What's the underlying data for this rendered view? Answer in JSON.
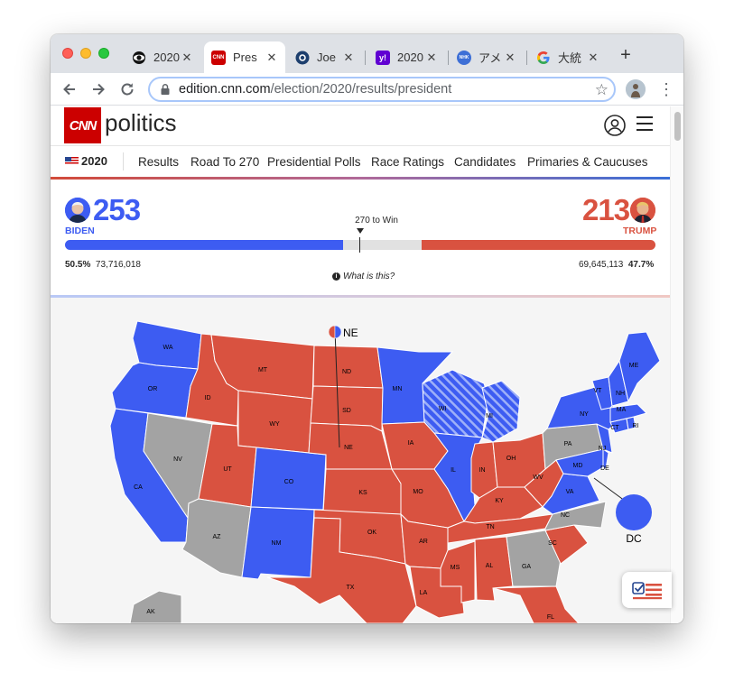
{
  "browser": {
    "tabs": [
      {
        "label": "2020",
        "icon": "cbs-eye-icon"
      },
      {
        "label": "Pres",
        "icon": "cnn-icon",
        "active": true
      },
      {
        "label": "Joe",
        "icon": "globe-icon"
      },
      {
        "label": "2020",
        "icon": "yahoo-icon"
      },
      {
        "label": "アメ",
        "icon": "nhk-icon"
      },
      {
        "label": "大統",
        "icon": "google-icon"
      }
    ],
    "url_host": "edition.cnn.com",
    "url_path": "/election/2020/results/president"
  },
  "cnn": {
    "logo": "CNN",
    "section": "politics",
    "nav": {
      "year": "2020",
      "links": [
        "Results",
        "Road To 270",
        "Presidential Polls",
        "Race Ratings",
        "Candidates",
        "Primaries & Caucuses"
      ]
    }
  },
  "tally": {
    "dem": {
      "name": "BIDEN",
      "electoral": "253",
      "pct": "50.5%",
      "popular": "73,716,018",
      "bar_fraction": 0.4706
    },
    "rep": {
      "name": "TRUMP",
      "electoral": "213",
      "pct": "47.7%",
      "popular": "69,645,113",
      "bar_fraction": 0.3959
    },
    "win_label": "270 to Win",
    "whatis": "What is this?"
  },
  "map": {
    "colors": {
      "dem": "#3d5cf2",
      "rep": "#d95240",
      "undecided": "#a3a3a3"
    },
    "labels": {
      "WA": "WA",
      "OR": "OR",
      "CA": "CA",
      "ID": "ID",
      "NV": "NV",
      "MT": "MT",
      "WY": "WY",
      "UT": "UT",
      "AZ": "AZ",
      "CO": "CO",
      "NM": "NM",
      "ND": "ND",
      "SD": "SD",
      "NE": "NE",
      "KS": "KS",
      "OK": "OK",
      "TX": "TX",
      "MN": "MN",
      "IA": "IA",
      "MO": "MO",
      "AR": "AR",
      "LA": "LA",
      "WI": "WI",
      "IL": "IL",
      "MS": "MS",
      "MI": "MI",
      "IN": "IN",
      "KY": "KY",
      "TN": "TN",
      "AL": "AL",
      "OH": "OH",
      "WV": "WV",
      "GA": "GA",
      "FL": "FL",
      "SC": "SC",
      "NC": "NC",
      "VA": "VA",
      "PA": "PA",
      "MD": "MD",
      "DE": "DE",
      "NJ": "NJ",
      "NY": "NY",
      "CT": "CT",
      "RI": "RI",
      "MA": "MA",
      "VT": "VT",
      "NH": "NH",
      "ME": "ME",
      "AK": "AK"
    },
    "dc_label": "DC",
    "ne_label": "NE"
  }
}
